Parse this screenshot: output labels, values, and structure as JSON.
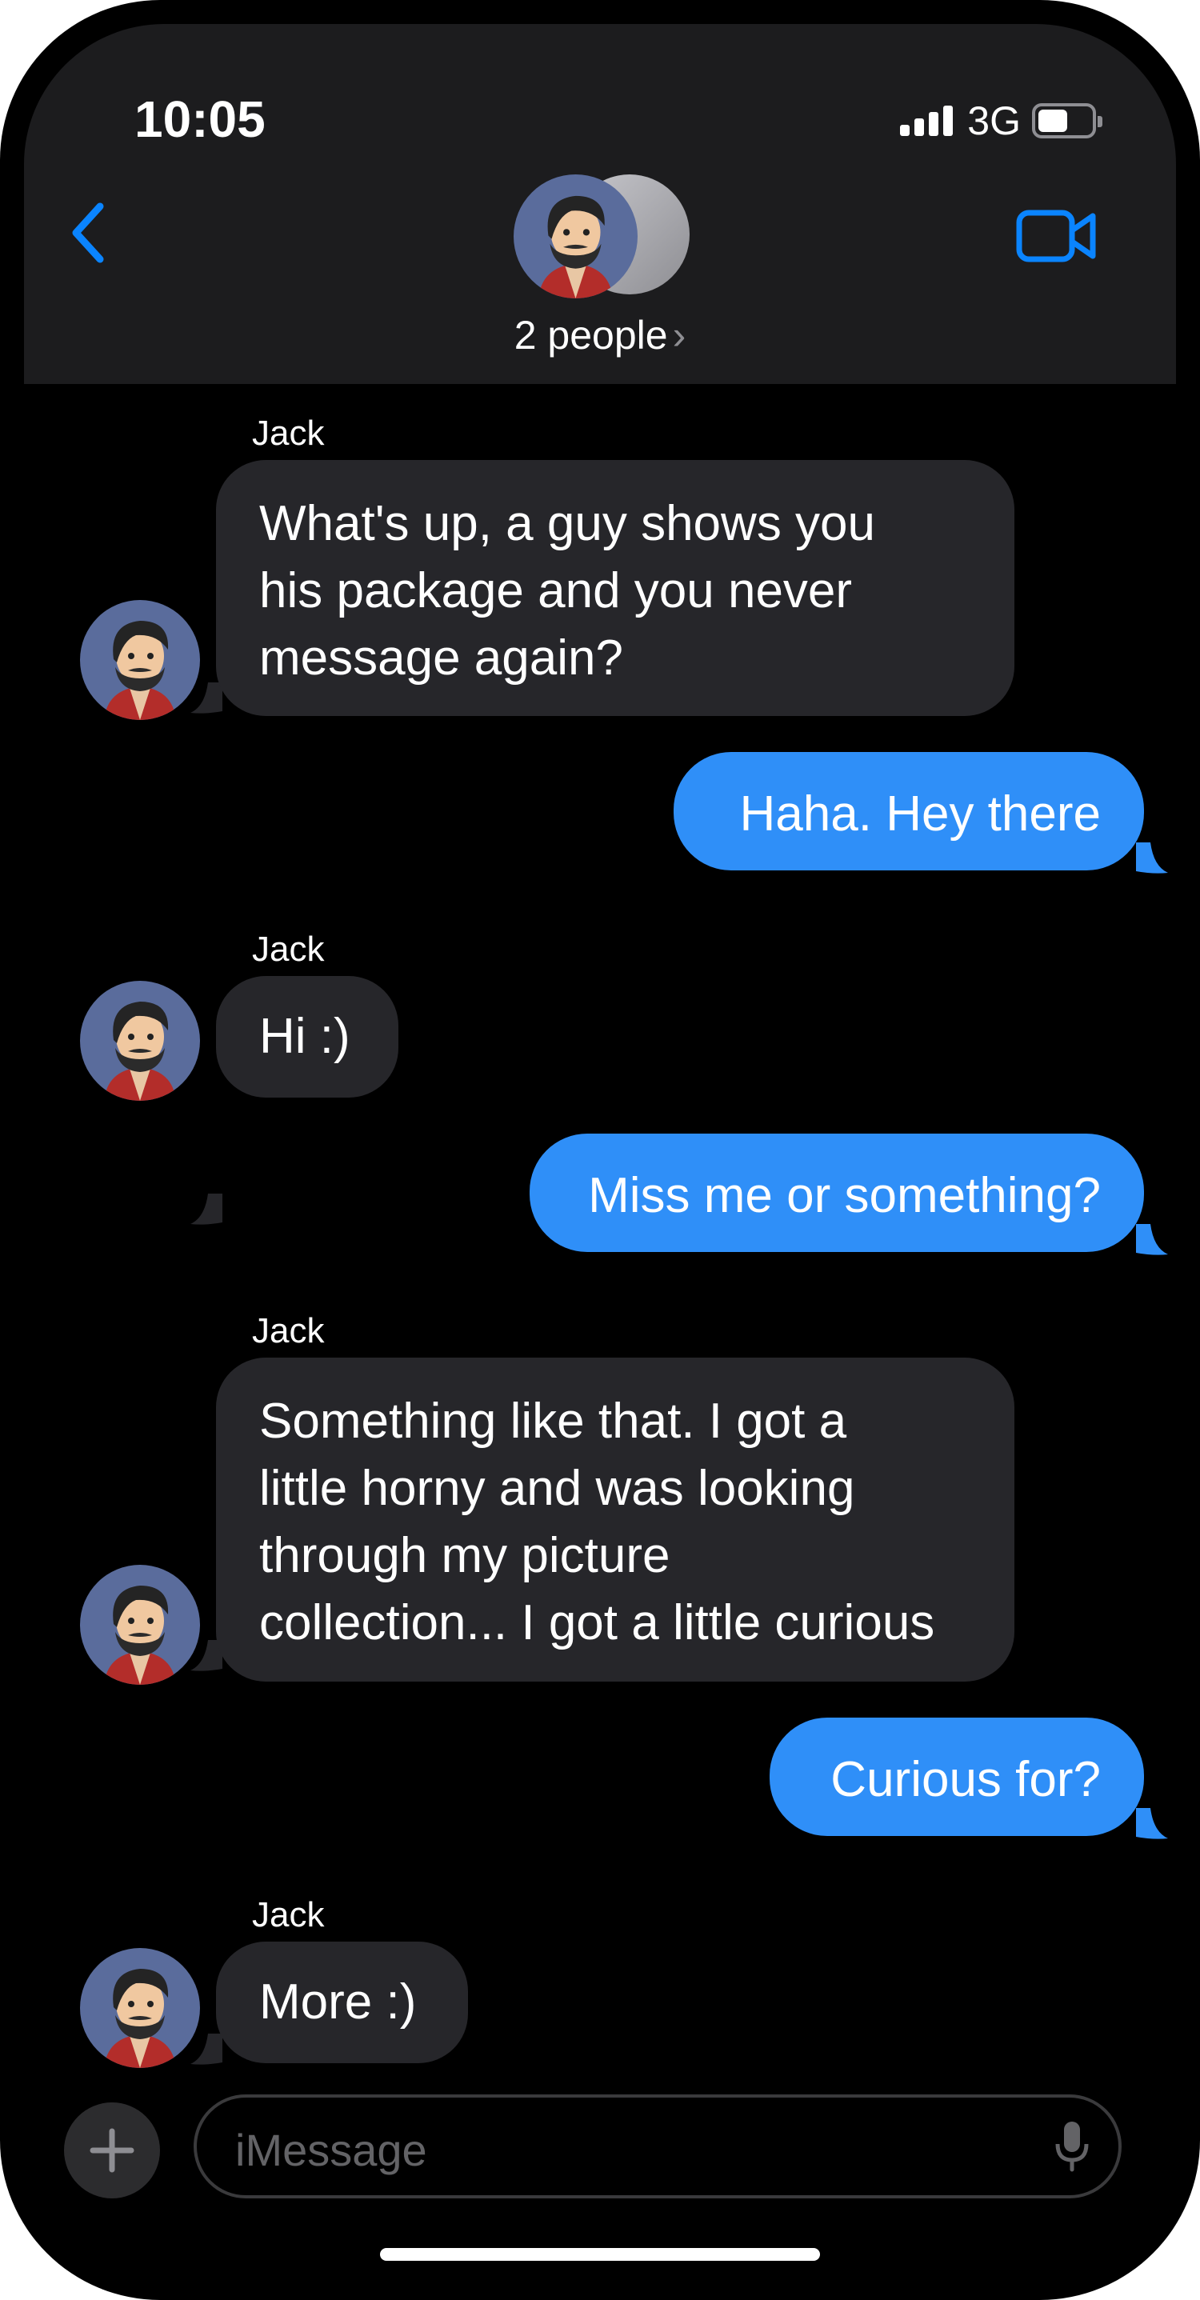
{
  "status_bar": {
    "time": "10:05",
    "network": "3G"
  },
  "header": {
    "title": "2 people",
    "chevron": "›",
    "back_icon": "chevron-left-icon",
    "video_icon": "video-camera-icon"
  },
  "messages": [
    {
      "sender": "Jack",
      "direction": "incoming",
      "lines": [
        "What's up, a guy shows you",
        "his package and you never",
        "message again?"
      ]
    },
    {
      "direction": "outgoing",
      "lines": [
        "Haha.  Hey there"
      ]
    },
    {
      "sender": "Jack",
      "direction": "incoming",
      "lines": [
        "Hi :)"
      ]
    },
    {
      "direction": "outgoing",
      "lines": [
        "Miss me or something?"
      ]
    },
    {
      "sender": "Jack",
      "direction": "incoming",
      "lines": [
        "Something like that.  I got a",
        "little horny and was looking",
        "through my picture",
        "collection... I got a little curious"
      ]
    },
    {
      "direction": "outgoing",
      "lines": [
        "Curious for?"
      ]
    },
    {
      "sender": "Jack",
      "direction": "incoming",
      "lines": [
        "More :)"
      ]
    }
  ],
  "composer": {
    "placeholder": "iMessage",
    "plus_icon": "plus-icon",
    "mic_icon": "microphone-icon"
  },
  "colors": {
    "outgoing_bubble": "#2f8ff8",
    "incoming_bubble": "#26262a",
    "accent": "#0a84ff",
    "background": "#000000"
  }
}
